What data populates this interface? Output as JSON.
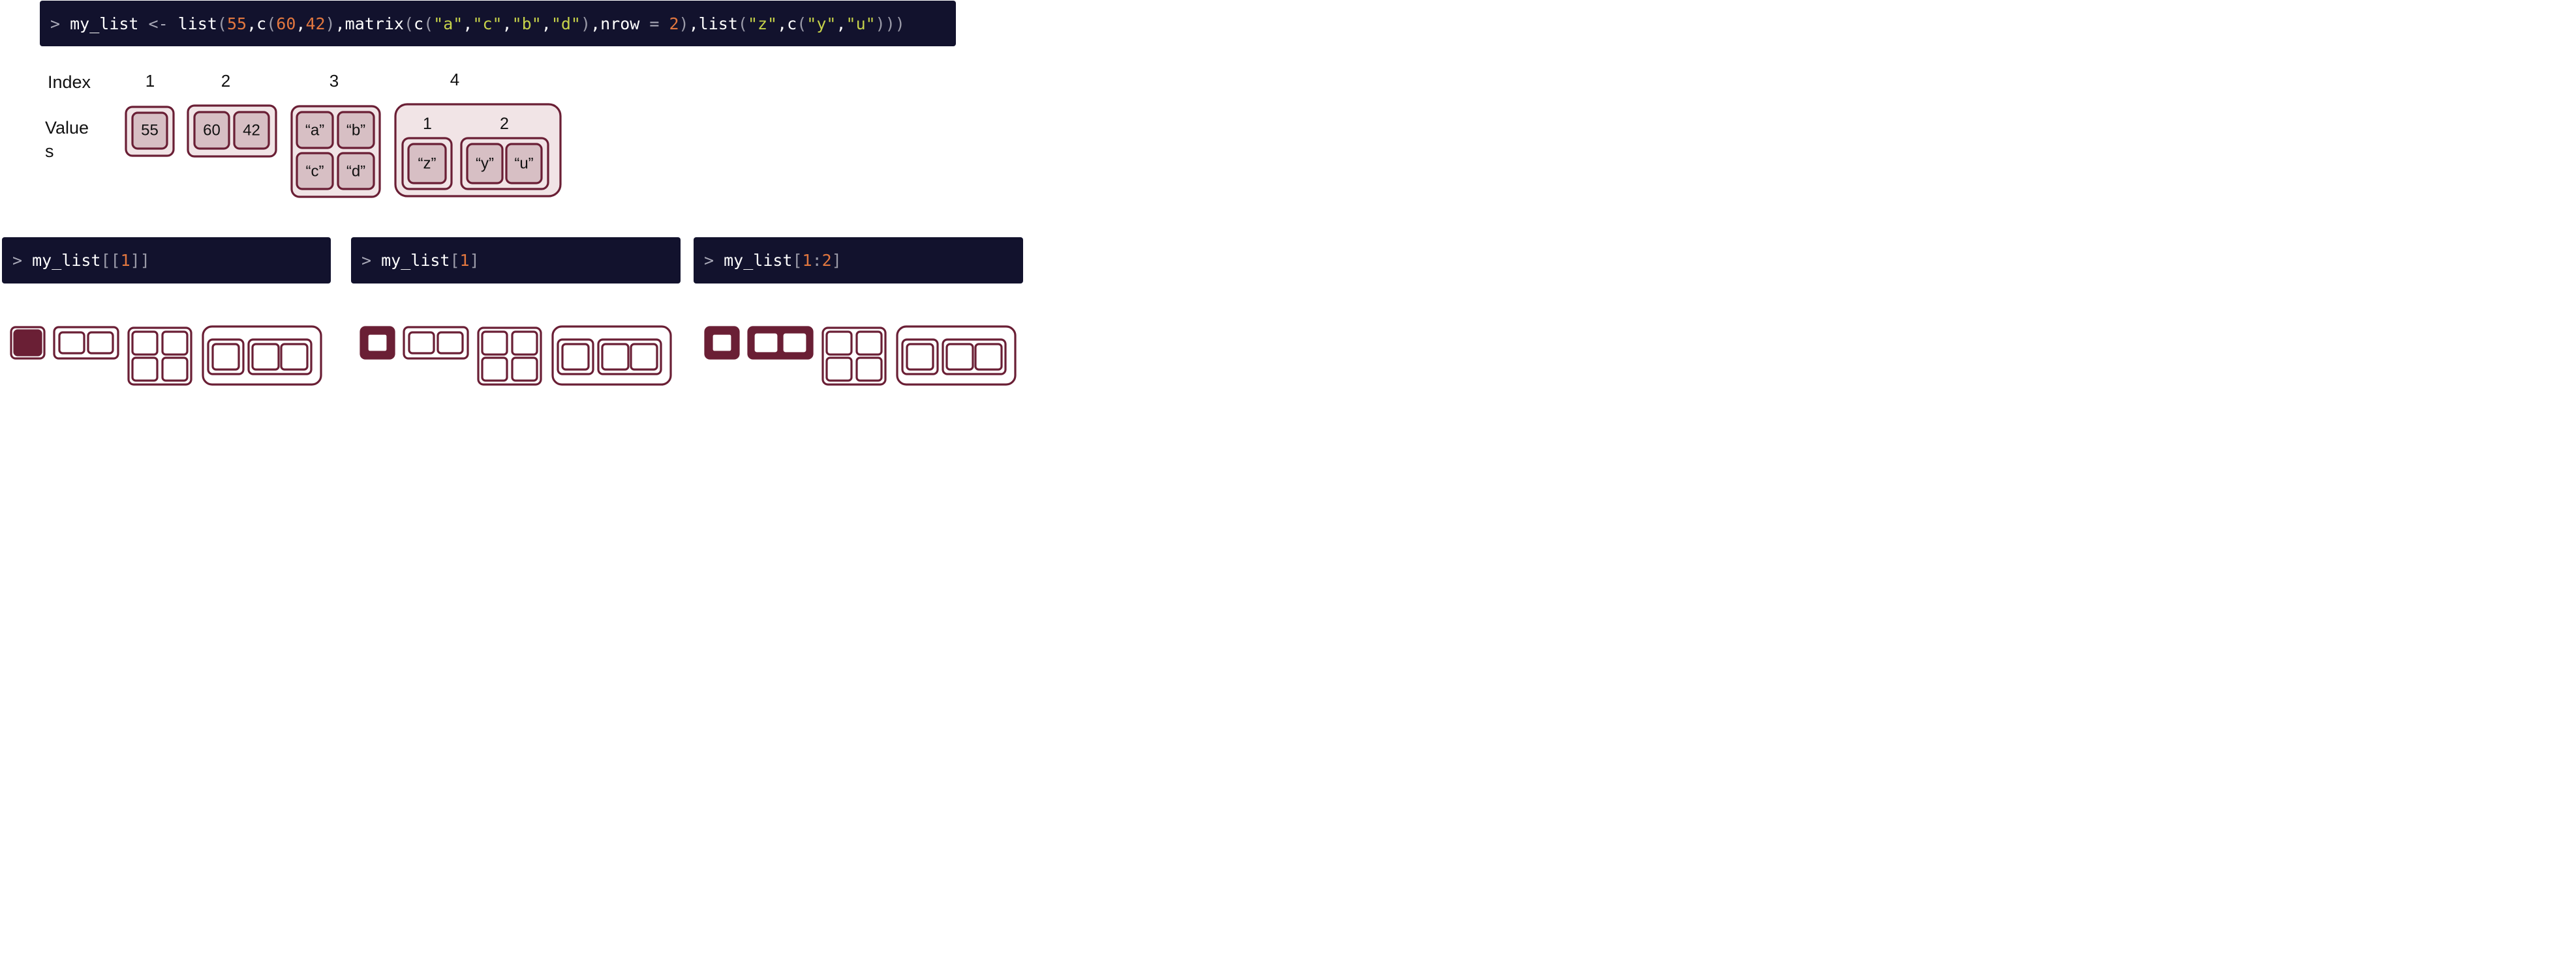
{
  "main_code": {
    "tokens": [
      {
        "t": "> ",
        "k": "prompt"
      },
      {
        "t": "my_list",
        "k": "plain"
      },
      {
        "t": " <- ",
        "k": "op"
      },
      {
        "t": "list",
        "k": "plain"
      },
      {
        "t": "(",
        "k": "paren"
      },
      {
        "t": "55",
        "k": "num"
      },
      {
        "t": ",",
        "k": "plain"
      },
      {
        "t": "c",
        "k": "plain"
      },
      {
        "t": "(",
        "k": "paren"
      },
      {
        "t": "60",
        "k": "num"
      },
      {
        "t": ",",
        "k": "plain"
      },
      {
        "t": "42",
        "k": "num"
      },
      {
        "t": ")",
        "k": "paren"
      },
      {
        "t": ",",
        "k": "plain"
      },
      {
        "t": "matrix",
        "k": "plain"
      },
      {
        "t": "(",
        "k": "paren"
      },
      {
        "t": "c",
        "k": "plain"
      },
      {
        "t": "(",
        "k": "paren"
      },
      {
        "t": "\"a\"",
        "k": "str"
      },
      {
        "t": ",",
        "k": "plain"
      },
      {
        "t": "\"c\"",
        "k": "str"
      },
      {
        "t": ",",
        "k": "plain"
      },
      {
        "t": "\"b\"",
        "k": "str"
      },
      {
        "t": ",",
        "k": "plain"
      },
      {
        "t": "\"d\"",
        "k": "str"
      },
      {
        "t": ")",
        "k": "paren"
      },
      {
        "t": ",",
        "k": "plain"
      },
      {
        "t": "nrow",
        "k": "plain"
      },
      {
        "t": " = ",
        "k": "op"
      },
      {
        "t": "2",
        "k": "num"
      },
      {
        "t": ")",
        "k": "paren"
      },
      {
        "t": ",",
        "k": "plain"
      },
      {
        "t": "list",
        "k": "plain"
      },
      {
        "t": "(",
        "k": "paren"
      },
      {
        "t": "\"z\"",
        "k": "str"
      },
      {
        "t": ",",
        "k": "plain"
      },
      {
        "t": "c",
        "k": "plain"
      },
      {
        "t": "(",
        "k": "paren"
      },
      {
        "t": "\"y\"",
        "k": "str"
      },
      {
        "t": ",",
        "k": "plain"
      },
      {
        "t": "\"u\"",
        "k": "str"
      },
      {
        "t": ")))",
        "k": "paren"
      }
    ]
  },
  "labels": {
    "index": "Index",
    "values_line1": "Value",
    "values_line2": "s"
  },
  "indices": [
    "1",
    "2",
    "3",
    "4"
  ],
  "values": {
    "el1": "55",
    "el2": [
      "60",
      "42"
    ],
    "el3": [
      "“a”",
      "“b”",
      "“c”",
      "“d”"
    ],
    "el4_sub_labels": [
      "1",
      "2"
    ],
    "el4_sub1": "“z”",
    "el4_sub2": [
      "“y”",
      "“u”"
    ]
  },
  "subset_panels": [
    {
      "tokens": [
        {
          "t": "> ",
          "k": "prompt"
        },
        {
          "t": "my_list",
          "k": "plain"
        },
        {
          "t": "[[",
          "k": "paren"
        },
        {
          "t": "1",
          "k": "num"
        },
        {
          "t": "]]",
          "k": "paren"
        }
      ],
      "selected": [
        1
      ]
    },
    {
      "tokens": [
        {
          "t": "> ",
          "k": "prompt"
        },
        {
          "t": "my_list",
          "k": "plain"
        },
        {
          "t": "[",
          "k": "paren"
        },
        {
          "t": "1",
          "k": "num"
        },
        {
          "t": "]",
          "k": "paren"
        }
      ],
      "selected": [
        1
      ]
    },
    {
      "tokens": [
        {
          "t": "> ",
          "k": "prompt"
        },
        {
          "t": "my_list",
          "k": "plain"
        },
        {
          "t": "[",
          "k": "paren"
        },
        {
          "t": "1",
          "k": "num"
        },
        {
          "t": ":",
          "k": "paren"
        },
        {
          "t": "2",
          "k": "num"
        },
        {
          "t": "]",
          "k": "paren"
        }
      ],
      "selected": [
        1,
        2
      ]
    }
  ],
  "colors": {
    "code_bg": "#12122d",
    "frame_stroke": "#6a1f35",
    "outer_fill": "#f1e4e6",
    "inner_fill": "#d7bfc4",
    "number": "#e2773f",
    "string": "#c6d24a"
  }
}
